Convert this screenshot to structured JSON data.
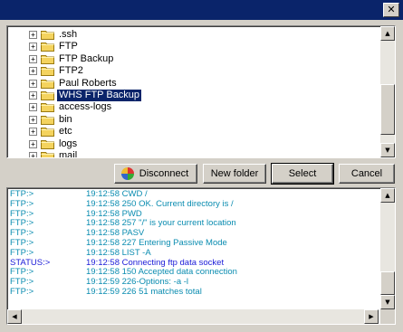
{
  "window": {
    "title": "",
    "close_glyph": "✕"
  },
  "tree": {
    "items": [
      {
        "label": ".ssh",
        "selected": false
      },
      {
        "label": "FTP",
        "selected": false
      },
      {
        "label": "FTP Backup",
        "selected": false
      },
      {
        "label": "FTP2",
        "selected": false
      },
      {
        "label": "Paul Roberts",
        "selected": false
      },
      {
        "label": "WHS FTP Backup",
        "selected": true
      },
      {
        "label": "access-logs",
        "selected": false
      },
      {
        "label": "bin",
        "selected": false
      },
      {
        "label": "etc",
        "selected": false
      },
      {
        "label": "logs",
        "selected": false
      },
      {
        "label": "mail",
        "selected": false
      }
    ],
    "expander_glyph": "+",
    "folder_icon": "folder-icon"
  },
  "buttons": {
    "disconnect": "Disconnect",
    "new_folder": "New folder",
    "select": "Select",
    "cancel": "Cancel"
  },
  "scroll": {
    "up": "▲",
    "down": "▼",
    "left": "◀",
    "right": "▶"
  },
  "log": {
    "entries": [
      {
        "source": "FTP:>",
        "message": "19:12:58 CWD /",
        "kind": "ftp"
      },
      {
        "source": "FTP:>",
        "message": "19:12:58 250 OK. Current directory is /",
        "kind": "ftp"
      },
      {
        "source": "FTP:>",
        "message": "19:12:58 PWD",
        "kind": "ftp"
      },
      {
        "source": "FTP:>",
        "message": "19:12:58 257 \"/\" is your current location",
        "kind": "ftp"
      },
      {
        "source": "FTP:>",
        "message": "19:12:58 PASV",
        "kind": "ftp"
      },
      {
        "source": "FTP:>",
        "message": "19:12:58 227 Entering Passive Mode",
        "kind": "ftp"
      },
      {
        "source": "FTP:>",
        "message": "19:12:58 LIST -A",
        "kind": "ftp"
      },
      {
        "source": "STATUS:>",
        "message": "19:12:58 Connecting ftp data socket",
        "kind": "status"
      },
      {
        "source": "FTP:>",
        "message": "19:12:58 150 Accepted data connection",
        "kind": "ftp"
      },
      {
        "source": "FTP:>",
        "message": "19:12:59 226-Options: -a -l",
        "kind": "ftp"
      },
      {
        "source": "FTP:>",
        "message": "19:12:59 226 51 matches total",
        "kind": "ftp"
      }
    ]
  },
  "colors": {
    "title_bar": "#0a246a",
    "ftp_text": "#0a8cb0",
    "status_text": "#1b1bd8",
    "selection": "#0a246a"
  }
}
